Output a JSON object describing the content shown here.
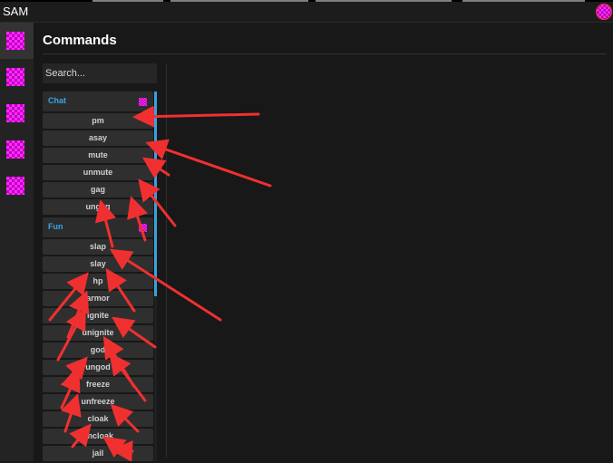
{
  "window": {
    "title": "SAM"
  },
  "colors": {
    "accent": "#3ba4e4",
    "arrow": "#f03030",
    "missing_texture": "#ff2cff"
  },
  "sidebar": {
    "items": [
      {
        "icon": "missing-texture-icon"
      },
      {
        "icon": "missing-texture-icon"
      },
      {
        "icon": "missing-texture-icon"
      },
      {
        "icon": "missing-texture-icon"
      },
      {
        "icon": "missing-texture-icon"
      }
    ]
  },
  "main": {
    "title": "Commands",
    "search": {
      "placeholder": "Search...",
      "value": ""
    },
    "categories": [
      {
        "name": "Chat",
        "icon": "missing-texture-icon",
        "commands": [
          "pm",
          "asay",
          "mute",
          "unmute",
          "gag",
          "ungag"
        ]
      },
      {
        "name": "Fun",
        "icon": "missing-texture-icon",
        "commands": [
          "slap",
          "slay",
          "hp",
          "armor",
          "ignite",
          "unignite",
          "god",
          "ungod",
          "freeze",
          "unfreeze",
          "cloak",
          "uncloak",
          "jail"
        ]
      }
    ]
  }
}
